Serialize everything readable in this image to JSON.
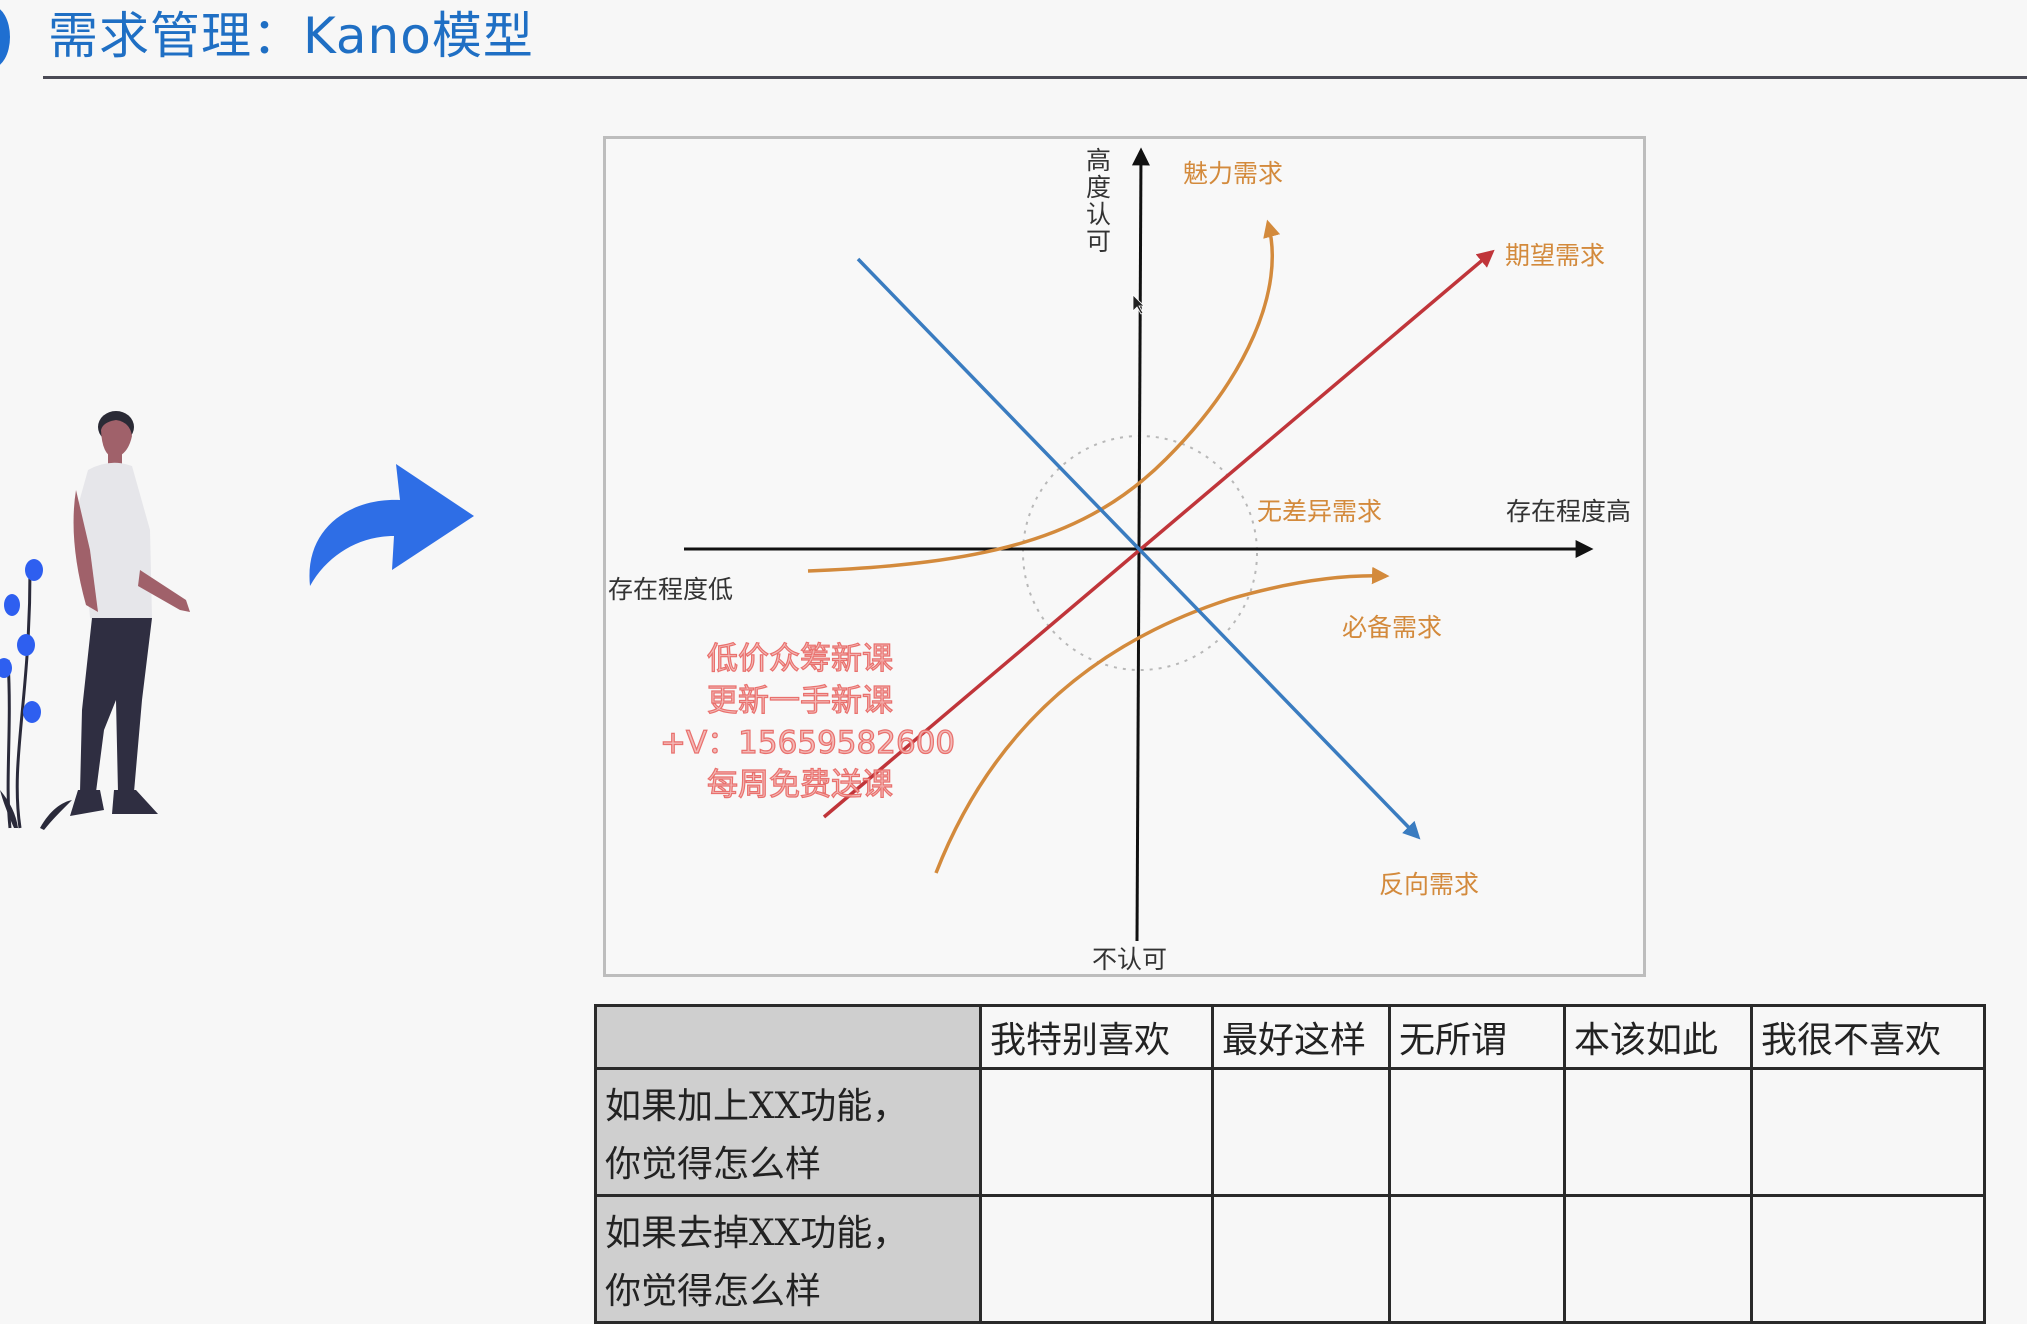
{
  "title": "需求管理：Kano模型",
  "diagram": {
    "y_axis_top": "高度认可",
    "y_axis_bottom": "不认可",
    "x_axis_right": "存在程度高",
    "x_axis_left": "存在程度低",
    "curves": [
      {
        "label": "魅力需求",
        "color": "#d38a3c"
      },
      {
        "label": "期望需求",
        "color": "#c0353a"
      },
      {
        "label": "无差异需求",
        "color": "#d38a3c"
      },
      {
        "label": "必备需求",
        "color": "#d38a3c"
      },
      {
        "label": "反向需求",
        "color": "#3a7cc0"
      }
    ]
  },
  "watermark": [
    "低价众筹新课",
    "更新一手新课",
    "+V：15659582600",
    "每周免费送课"
  ],
  "table": {
    "columns": [
      "我特别喜欢",
      "最好这样",
      "无所谓",
      "本该如此",
      "我很不喜欢"
    ],
    "rows": [
      {
        "line1": "如果加上XX功能，",
        "line2": "你觉得怎么样"
      },
      {
        "line1": "如果去掉XX功能，",
        "line2": "你觉得怎么样"
      }
    ]
  },
  "colors": {
    "title": "#1f6fc4",
    "accent_arrow": "#2e6ee6",
    "figure_plant": "#2e5ff0"
  }
}
